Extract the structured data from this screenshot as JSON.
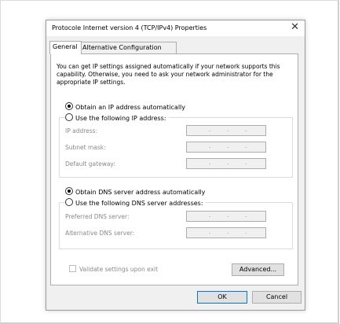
{
  "window": {
    "title": "Protocole Internet version 4 (TCP/IPv4) Properties",
    "close_glyph": "✕"
  },
  "tabs": [
    {
      "label": "General"
    },
    {
      "label": "Alternative Configuration"
    }
  ],
  "intro_text": "You can get IP settings assigned automatically if your network supports this capability. Otherwise, you need to ask your network administrator for the appropriate IP settings.",
  "ip": {
    "auto_label": "Obtain an IP address automatically",
    "manual_label": "Use the following IP address:",
    "selected": "auto",
    "fields": [
      {
        "label": "IP address:",
        "value": ". . ."
      },
      {
        "label": "Subnet mask:",
        "value": ". . ."
      },
      {
        "label": "Default gateway:",
        "value": ". . ."
      }
    ]
  },
  "dns": {
    "auto_label": "Obtain DNS server address automatically",
    "manual_label": "Use the following DNS server addresses:",
    "selected": "auto",
    "fields": [
      {
        "label": "Preferred DNS server:",
        "value": ". . ."
      },
      {
        "label": "Alternative DNS server:",
        "value": ". . ."
      }
    ]
  },
  "validate_label": "Validate settings upon exit",
  "buttons": {
    "advanced": "Advanced...",
    "ok": "OK",
    "cancel": "Cancel"
  },
  "colors": {
    "dialog_bg": "#f0f0f0",
    "focus_border": "#0078d7"
  }
}
